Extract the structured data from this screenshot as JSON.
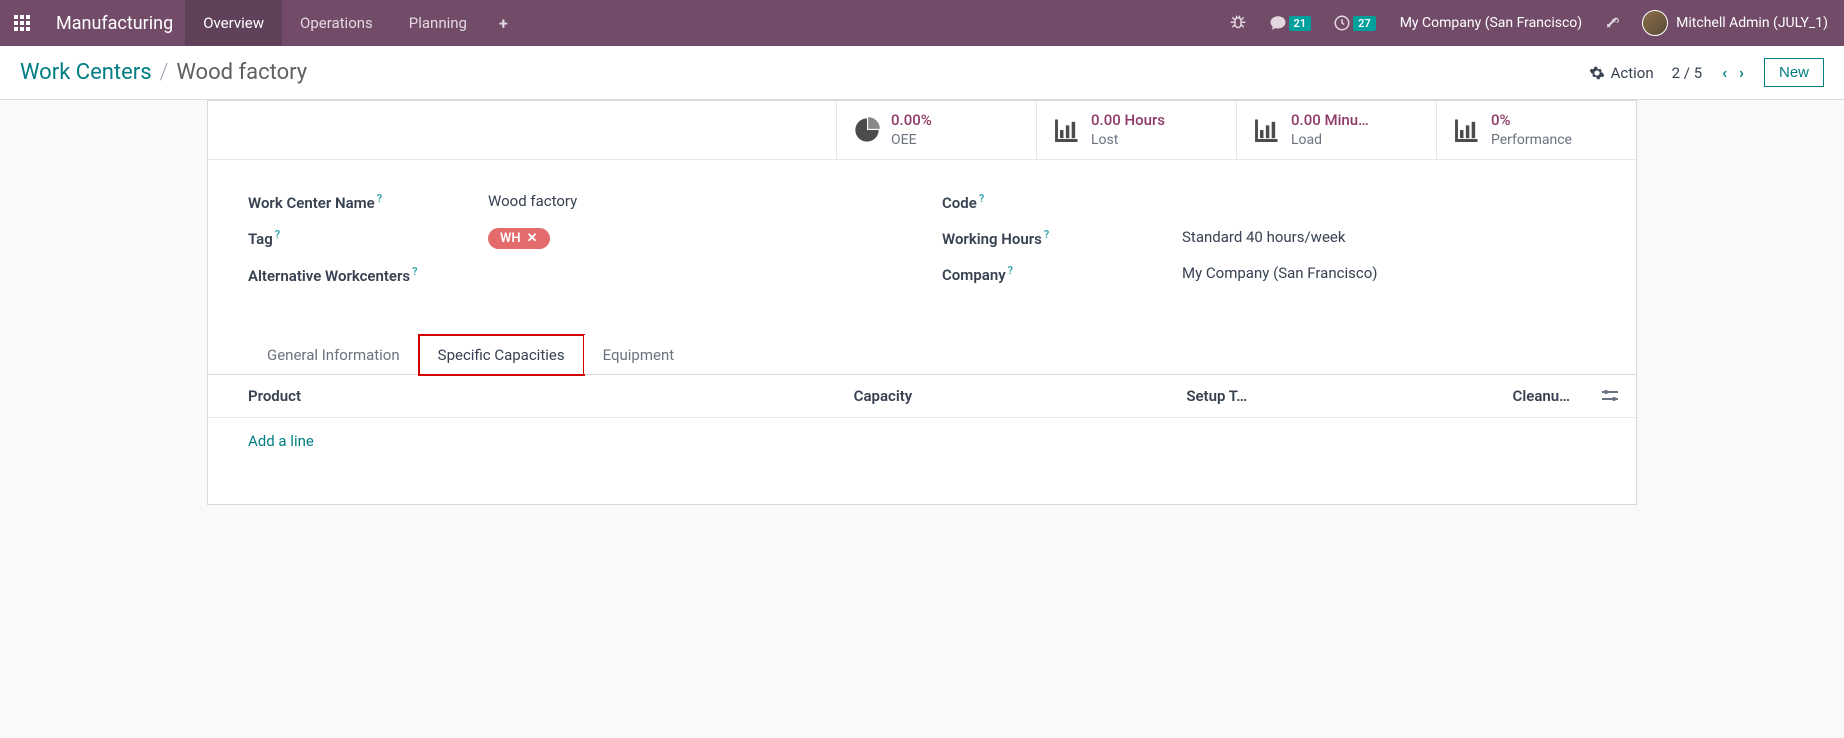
{
  "navbar": {
    "brand": "Manufacturing",
    "menu": [
      "Overview",
      "Operations",
      "Planning"
    ],
    "messages_badge": "21",
    "activities_badge": "27",
    "company": "My Company (San Francisco)",
    "user": "Mitchell Admin (JULY_1)"
  },
  "toolbar": {
    "breadcrumb_parent": "Work Centers",
    "breadcrumb_current": "Wood factory",
    "action_label": "Action",
    "pager": "2 / 5",
    "new_label": "New"
  },
  "stats": [
    {
      "value": "0.00%",
      "label": "OEE",
      "icon": "pie"
    },
    {
      "value": "0.00 Hours",
      "label": "Lost",
      "icon": "bar"
    },
    {
      "value": "0.00 Minu…",
      "label": "Load",
      "icon": "bar"
    },
    {
      "value": "0%",
      "label": "Performance",
      "icon": "bar"
    }
  ],
  "fields": {
    "name_label": "Work Center Name",
    "name_value": "Wood factory",
    "tag_label": "Tag",
    "tag_value": "WH",
    "alt_label": "Alternative Workcenters",
    "alt_value": "",
    "code_label": "Code",
    "code_value": "",
    "hours_label": "Working Hours",
    "hours_value": "Standard 40 hours/week",
    "company_label": "Company",
    "company_value": "My Company (San Francisco)"
  },
  "tabs": [
    "General Information",
    "Specific Capacities",
    "Equipment"
  ],
  "table": {
    "headers": [
      "Product",
      "Capacity",
      "Setup T…",
      "Cleanu…"
    ],
    "add_line": "Add a line"
  }
}
